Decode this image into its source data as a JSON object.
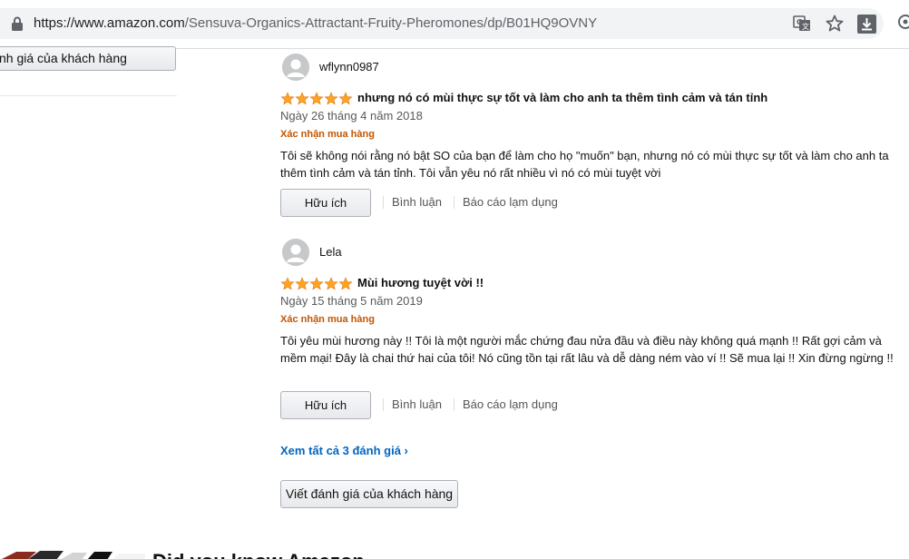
{
  "browser": {
    "url_base": "https://www.amazon.com",
    "url_path": "/Sensuva-Organics-Attractant-Fruity-Pheromones/dp/B01HQ9OVNY",
    "icons": [
      "lock-icon",
      "translate-icon",
      "star-icon",
      "download-icon",
      "extension-icon"
    ]
  },
  "sidebar": {
    "write_review_label": "nh giá của khách hàng"
  },
  "reviews": [
    {
      "name": "wflynn0987",
      "rating": 5,
      "title": "nhưng nó có mùi thực sự tốt và làm cho anh ta thêm tình cảm và tán tỉnh",
      "date": "Ngày 26 tháng 4 năm 2018",
      "verified": "Xác nhận mua hàng",
      "body": "Tôi sẽ không nói rằng nó bật SO của bạn để làm cho họ \"muốn\" bạn, nhưng nó có mùi thực sự tốt và làm cho anh ta thêm tình cảm và tán tỉnh. Tôi vẫn yêu nó rất nhiều vì nó có mùi tuyệt vời",
      "helpful_label": "Hữu ích",
      "comment_label": "Bình luận",
      "report_label": "Báo cáo lạm dụng"
    },
    {
      "name": "Lela",
      "rating": 5,
      "title": "Mùi hương tuyệt vời !!",
      "date": "Ngày 15 tháng 5 năm 2019",
      "verified": "Xác nhận mua hàng",
      "body": "Tôi yêu mùi hương này !! Tôi là một người mắc chứng đau nửa đầu và điều này không quá mạnh !! Rất gợi cảm và mềm mại! Đây là chai thứ hai của tôi! Nó cũng tồn tại rất lâu và dễ dàng ném vào ví !! Sẽ mua lại !! Xin đừng ngừng !!",
      "helpful_label": "Hữu ích",
      "comment_label": "Bình luận",
      "report_label": "Báo cáo lạm dụng"
    }
  ],
  "see_all_label": "Xem tất cả 3 đánh giá ›",
  "write_review_label": "Viết đánh giá của khách hàng",
  "bottom_heading": "Did you know Amazon",
  "colors": {
    "star": "#ffa41c",
    "verified": "#c45500",
    "link": "#0066c0"
  }
}
